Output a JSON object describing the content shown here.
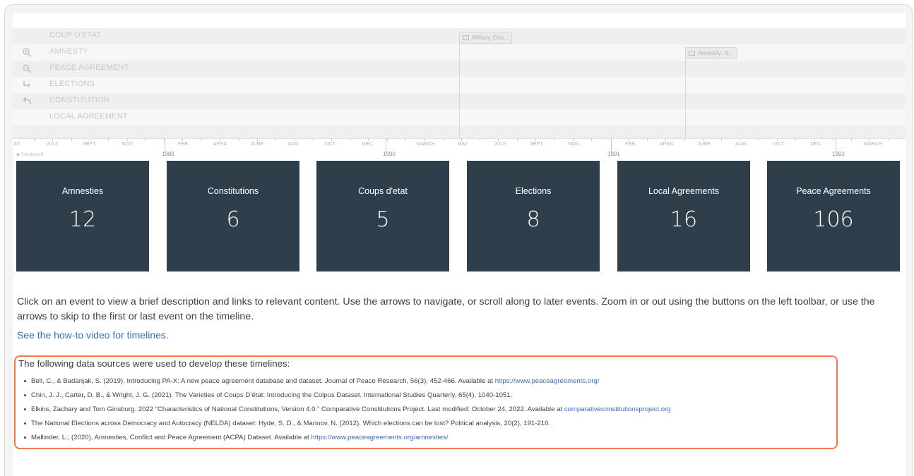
{
  "timeline": {
    "rows": [
      "COUP D'ETAT",
      "AMNESTY",
      "PEACE AGREEMENT",
      "ELECTIONS",
      "CONSTITUTION",
      "LOCAL AGREEMENT"
    ],
    "events": [
      {
        "label": "Military Cou..."
      },
      {
        "label": "Amnesty: S..."
      }
    ],
    "months": [
      "AY",
      "JULY",
      "SEPT.",
      "NOV.",
      "FEB.",
      "APRIL",
      "JUNE",
      "AUG.",
      "OCT.",
      "DEC.",
      "MARCH",
      "MAY",
      "JULY",
      "SEPT.",
      "NOV.",
      "FEB.",
      "APRIL",
      "JUNE",
      "AUG.",
      "OCT.",
      "DEC.",
      "MARCH"
    ],
    "years": [
      "1989",
      "1990",
      "1991",
      "1992"
    ],
    "brand": "TimelineJS",
    "tools": [
      "zoom-in-icon",
      "zoom-out-icon",
      "return-to-start-icon",
      "back-icon"
    ]
  },
  "cards": [
    {
      "label": "Amnesties",
      "value": "12"
    },
    {
      "label": "Constitutions",
      "value": "6"
    },
    {
      "label": "Coups d'etat",
      "value": "5"
    },
    {
      "label": "Elections",
      "value": "8"
    },
    {
      "label": "Local Agreements",
      "value": "16"
    },
    {
      "label": "Peace Agreements",
      "value": "106"
    }
  ],
  "instructions": "Click on an event to view a brief description and links to relevant content. Use the arrows to navigate, or scroll along to later events. Zoom in or out using the buttons on the left toolbar, or use the arrows to skip to the first or last event on the timeline.",
  "howto_link": "See the how-to video for timelines.",
  "sources": {
    "title": "The following data sources were used to develop these timelines:",
    "items": [
      {
        "text": "Bell, C., & Badanjak, S. (2019). Introducing PA-X: A new peace agreement database and dataset. Journal of Peace Research, 56(3), 452-466. Available at ",
        "link": "https://www.peaceagreements.org/"
      },
      {
        "text": "Chin, J. J., Carter, D. B., & Wright, J. G. (2021). The Varieties of Coups D’état: Introducing the Colpus Dataset. International Studies Quarterly, 65(4), 1040-1051.",
        "link": ""
      },
      {
        "text": "Elkins, Zachary and Tom Ginsburg. 2022 “Characteristics of National Constitutions, Version 4.0.” Comparative Constitutions Project. Last modified: October 24, 2022. Available at ",
        "link": "comparativeconstitutionsproject.org"
      },
      {
        "text": "The National Elections across Democracy and Autocracy (NELDA) dataset: Hyde, S. D., & Marinov, N. (2012). Which elections can be lost? Political analysis, 20(2), 191-210.",
        "link": ""
      },
      {
        "text": "Mallinder, L., (2020), Amnesties, Conflict and Peace Agreement (ACPA) Dataset. Available at ",
        "link": "https://www.peaceagreements.org/amnesties/"
      }
    ]
  },
  "colors": {
    "card_bg": "#2e3e4b",
    "link": "#3a6fb3",
    "highlight_border": "#f07a4e"
  }
}
